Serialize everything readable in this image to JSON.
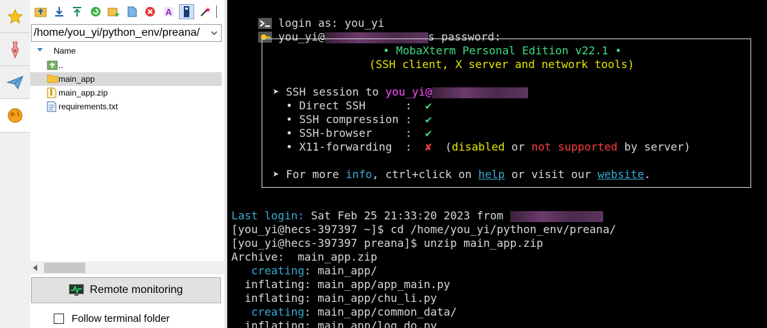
{
  "sftp": {
    "path": "/home/you_yi/python_env/preana/",
    "column_name": "Name",
    "files": [
      {
        "name": "..",
        "icon": "folder-up-icon"
      },
      {
        "name": "main_app",
        "icon": "folder-icon",
        "selected": true
      },
      {
        "name": "main_app.zip",
        "icon": "zip-file-icon"
      },
      {
        "name": "requirements.txt",
        "icon": "text-file-icon"
      }
    ],
    "remote_monitoring_label": "Remote monitoring",
    "follow_terminal_label": "Follow terminal folder",
    "follow_terminal_checked": false
  },
  "terminal": {
    "login_as": "login as: you_yi",
    "password_prefix": "you_yi@",
    "password_suffix": "s password:",
    "banner_title": "• MobaXterm Personal Edition v22.1 •",
    "banner_subtitle": "(SSH client, X server and network tools)",
    "ssh_session_prefix": "➤ SSH session to ",
    "ssh_user": "you_yi@",
    "features": [
      {
        "label": "  • Direct SSH      :  ",
        "status": "✔",
        "ok": true
      },
      {
        "label": "  • SSH compression :  ",
        "status": "✔",
        "ok": true
      },
      {
        "label": "  • SSH-browser     :  ",
        "status": "✔",
        "ok": true
      },
      {
        "label": "  • X11-forwarding  :  ",
        "status": "✘",
        "ok": false
      }
    ],
    "x11_note_open": "  (",
    "x11_disabled": "disabled",
    "x11_or": " or ",
    "x11_not_supported": "not supported",
    "x11_by_server": " by server)",
    "more_prefix": "➤ For more ",
    "more_info": "info",
    "more_mid": ", ctrl+click on ",
    "more_help": "help",
    "more_or": " or visit our ",
    "more_website": "website",
    "more_end": ".",
    "last_login_label": "Last login:",
    "last_login_value": " Sat Feb 25 21:33:20 2023 from ",
    "cmd1": "[you_yi@hecs-397397 ~]$ cd /home/you_yi/python_env/preana/",
    "cmd2": "[you_yi@hecs-397397 preana]$ unzip main_app.zip",
    "archive": "Archive:  main_app.zip",
    "out": [
      {
        "action": "   creating",
        "path": ": main_app/",
        "cyan": true
      },
      {
        "action": "  inflating",
        "path": ": main_app/app_main.py",
        "cyan": false
      },
      {
        "action": "  inflating",
        "path": ": main_app/chu_li.py",
        "cyan": false
      },
      {
        "action": "   creating",
        "path": ": main_app/common_data/",
        "cyan": true
      },
      {
        "action": "  inflating",
        "path": ": main_app/log_do.py",
        "cyan": false
      }
    ]
  },
  "colors": {
    "terminal_bg": "#000000",
    "terminal_fg": "#d8d8d8",
    "green": "#3ddc84",
    "yellow": "#e6e600",
    "magenta": "#ff4dff",
    "cyan": "#3aa9d6",
    "red": "#ff3b3b"
  }
}
